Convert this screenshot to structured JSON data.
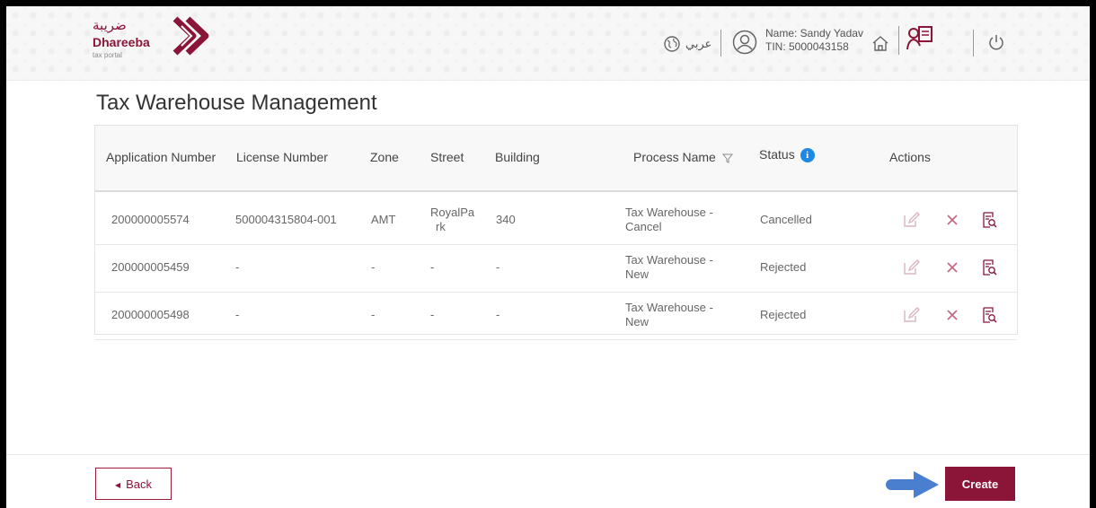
{
  "header": {
    "logo": {
      "arabic": "ضريبة",
      "name": "Dhareeba",
      "subtitle": "tax portal"
    },
    "language_label": "عربي",
    "user": {
      "name": "Name: Sandy Yadav",
      "tin": "TIN: 5000043158"
    },
    "icons": [
      "globe-icon",
      "user-icon",
      "home-icon",
      "documents-icon",
      "power-icon"
    ]
  },
  "page": {
    "title": "Tax Warehouse Management"
  },
  "table": {
    "headers": {
      "application_number": "Application Number",
      "license_number": "License Number",
      "zone": "Zone",
      "street": "Street",
      "building": "Building",
      "process_name": "Process Name",
      "status": "Status",
      "actions": "Actions"
    },
    "rows": [
      {
        "application_number": "200000005574",
        "license_number": "500004315804-001",
        "zone": "AMT",
        "street_line1": "RoyalPa",
        "street_line2": "rk",
        "building": "340",
        "process_line1": "Tax Warehouse -",
        "process_line2": "Cancel",
        "status": "Cancelled"
      },
      {
        "application_number": "200000005459",
        "license_number": "-",
        "zone": "-",
        "street_line1": "-",
        "street_line2": "",
        "building": "-",
        "process_line1": "Tax Warehouse -",
        "process_line2": "New",
        "status": "Rejected"
      },
      {
        "application_number": "200000005498",
        "license_number": "-",
        "zone": "-",
        "street_line1": "-",
        "street_line2": "",
        "building": "-",
        "process_line1": "Tax Warehouse -",
        "process_line2": "New",
        "status": "Rejected"
      }
    ]
  },
  "footer": {
    "back_label": "Back",
    "create_label": "Create"
  },
  "colors": {
    "brand": "#8a1538",
    "info": "#1e88e5",
    "arrow": "#4a7fd0",
    "action_icon": "#c9a0ad"
  }
}
